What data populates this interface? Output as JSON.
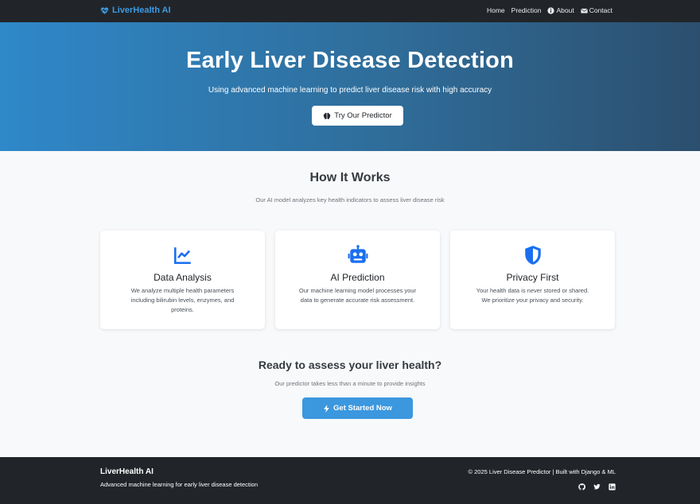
{
  "navbar": {
    "brand": "LiverHealth AI",
    "links": [
      {
        "label": "Home"
      },
      {
        "label": "Prediction"
      },
      {
        "label": "About"
      },
      {
        "label": "Contact"
      }
    ]
  },
  "hero": {
    "title": "Early Liver Disease Detection",
    "subtitle": "Using advanced machine learning to predict liver disease risk with high accuracy",
    "button": "Try Our Predictor"
  },
  "how": {
    "title": "How It Works",
    "subtitle": "Our AI model analyzes key health indicators to assess liver disease risk",
    "cards": [
      {
        "icon": "chart-line-icon",
        "title": "Data Analysis",
        "text": "We analyze multiple health parameters including bilirubin levels, enzymes, and proteins."
      },
      {
        "icon": "robot-icon",
        "title": "AI Prediction",
        "text": "Our machine learning model processes your data to generate accurate risk assessment."
      },
      {
        "icon": "shield-icon",
        "title": "Privacy First",
        "text": "Your health data is never stored or shared. We prioritize your privacy and security."
      }
    ]
  },
  "cta": {
    "title": "Ready to assess your liver health?",
    "subtitle": "Our predictor takes less than a minute to provide insights",
    "button": "Get Started Now"
  },
  "footer": {
    "brand": "LiverHealth AI",
    "description": "Advanced machine learning for early liver disease detection",
    "copyright": "© 2025 Liver Disease Predictor | Built with Django & ML",
    "social": [
      "github-icon",
      "twitter-icon",
      "linkedin-icon"
    ]
  },
  "colors": {
    "accent": "#3b97de",
    "icon": "#1a6ff0",
    "dark": "#212529"
  }
}
